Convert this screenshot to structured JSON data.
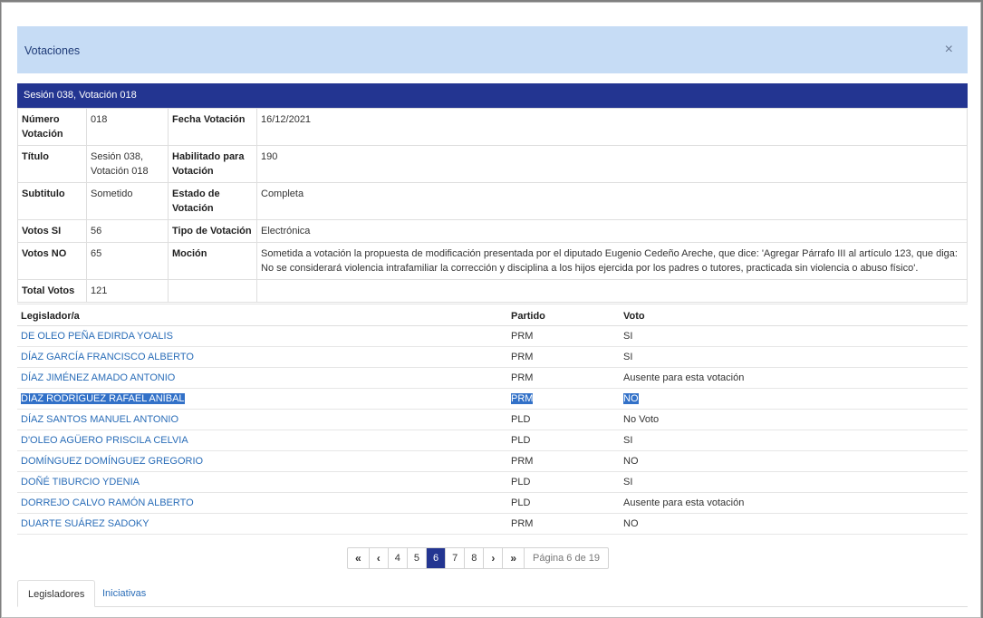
{
  "modal": {
    "title": "Votaciones",
    "close": "×"
  },
  "session": {
    "title": "Sesión 038, Votación 018",
    "fields": {
      "numero_label": "Número Votación",
      "numero": "018",
      "fecha_label": "Fecha Votación",
      "fecha": "16/12/2021",
      "titulo_label": "Título",
      "titulo": "Sesión 038, Votación 018",
      "habilitado_label": "Habilitado para Votación",
      "habilitado": "190",
      "subtitulo_label": "Subtitulo",
      "subtitulo": "Sometido",
      "estado_label": "Estado de Votación",
      "estado": "Completa",
      "si_label": "Votos SI",
      "si": "56",
      "tipo_label": "Tipo de Votación",
      "tipo": "Electrónica",
      "no_label": "Votos NO",
      "no": "65",
      "mocion_label": "Moción",
      "mocion": "Sometida a votación la propuesta de modificación presentada por el diputado Eugenio Cedeño Areche, que dice: 'Agregar Párrafo III al artículo 123, que diga: No se considerará violencia intrafamiliar la corrección y disciplina a los hijos ejercida por los padres o tutores, practicada sin violencia o abuso físico'.",
      "total_label": "Total Votos",
      "total": "121"
    }
  },
  "legislators": {
    "headers": {
      "name": "Legislador/a",
      "party": "Partido",
      "vote": "Voto"
    },
    "rows": [
      {
        "name": "DE OLEO PEÑA EDIRDA YOALIS",
        "party": "PRM",
        "vote": "SI"
      },
      {
        "name": "DÍAZ GARCÍA FRANCISCO ALBERTO",
        "party": "PRM",
        "vote": "SI"
      },
      {
        "name": "DÍAZ JIMÉNEZ AMADO ANTONIO",
        "party": "PRM",
        "vote": "Ausente para esta votación"
      },
      {
        "name": "DÍAZ RODRÍGUEZ RAFAEL ANÍBAL",
        "party": "PRM",
        "vote": "NO"
      },
      {
        "name": "DÍAZ SANTOS MANUEL ANTONIO",
        "party": "PLD",
        "vote": "No Voto"
      },
      {
        "name": "D'OLEO AGÜERO PRISCILA CELVIA",
        "party": "PLD",
        "vote": "SI"
      },
      {
        "name": "DOMÍNGUEZ DOMÍNGUEZ GREGORIO",
        "party": "PRM",
        "vote": "NO"
      },
      {
        "name": "DOÑÉ TIBURCIO YDENIA",
        "party": "PLD",
        "vote": "SI"
      },
      {
        "name": "DORREJO CALVO RAMÓN ALBERTO",
        "party": "PLD",
        "vote": "Ausente para esta votación"
      },
      {
        "name": "DUARTE SUÁREZ SADOKY",
        "party": "PRM",
        "vote": "NO"
      }
    ]
  },
  "pagination": {
    "first": "«",
    "prev": "‹",
    "next": "›",
    "last": "»",
    "pages": [
      "4",
      "5",
      "6",
      "7",
      "8"
    ],
    "info": "Página 6 de 19"
  },
  "tabs": {
    "legisladores": "Legisladores",
    "iniciativas": "Iniciativas"
  }
}
